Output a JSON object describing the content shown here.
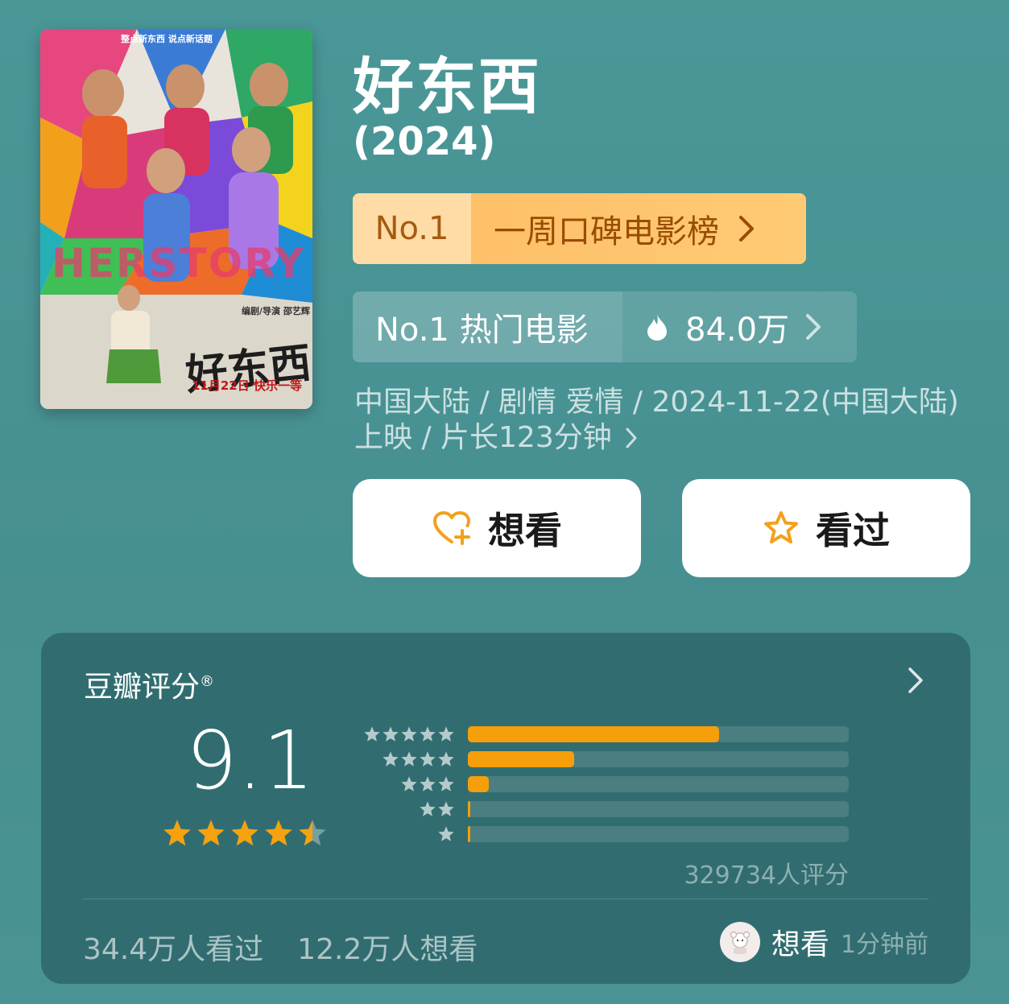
{
  "movie": {
    "title": "好东西",
    "year": "(2024)",
    "meta_line1": "中国大陆 / 剧情 爱情 / 2024-11-22(中国大陆)",
    "meta_line2": "上映 / 片长123分钟"
  },
  "poster": {
    "tagline": "整点新东西  说点新话题",
    "overlay_text": "HERSTORY",
    "director": "编剧/导演 邵艺辉",
    "poster_title": "好东西",
    "release": "11月22日 快乐一等"
  },
  "rank_weekly": {
    "number": "No.1",
    "label": "一周口碑电影榜"
  },
  "rank_hot": {
    "label": "No.1 热门电影",
    "heat": "84.0万"
  },
  "actions": {
    "want_label": "想看",
    "seen_label": "看过"
  },
  "rating": {
    "title": "豆瓣评分",
    "registered": "®",
    "score": "9.1",
    "stars_value": 4.5,
    "distribution": [
      {
        "stars": 5,
        "fraction": 0.66
      },
      {
        "stars": 4,
        "fraction": 0.28
      },
      {
        "stars": 3,
        "fraction": 0.055
      },
      {
        "stars": 2,
        "fraction": 0.006
      },
      {
        "stars": 1,
        "fraction": 0.004
      }
    ],
    "count": "329734人评分",
    "seen_count": "34.4万人看过",
    "want_count": "12.2万人想看",
    "activity_label": "想看",
    "activity_time": "1分钟前"
  },
  "colors": {
    "background": "#4a9798",
    "card": "#316d70",
    "accent_orange": "#f59f0a",
    "rank_gold": "#fec068"
  }
}
